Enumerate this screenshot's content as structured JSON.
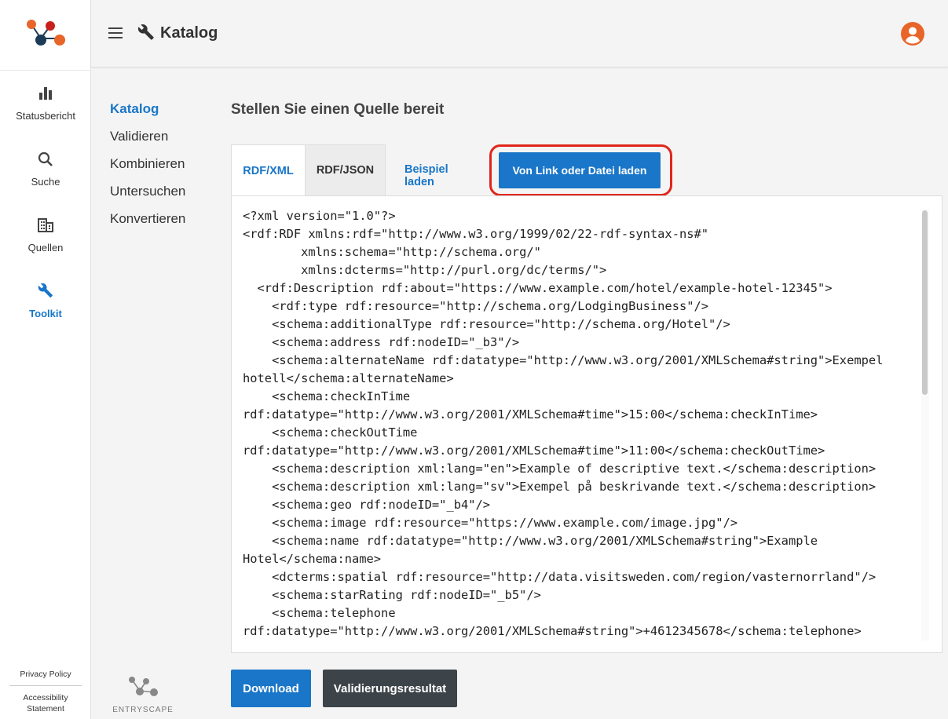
{
  "rail": {
    "items": [
      {
        "label": "Statusbericht",
        "icon": "bar-chart-icon"
      },
      {
        "label": "Suche",
        "icon": "search-icon"
      },
      {
        "label": "Quellen",
        "icon": "building-icon"
      },
      {
        "label": "Toolkit",
        "icon": "wrench-icon"
      }
    ],
    "footer": {
      "privacy": "Privacy Policy",
      "accessibility_1": "Accessibility",
      "accessibility_2": "Statement"
    }
  },
  "header": {
    "title": "Katalog"
  },
  "subnav": [
    "Katalog",
    "Validieren",
    "Kombinieren",
    "Untersuchen",
    "Konvertieren"
  ],
  "main": {
    "title": "Stellen Sie einen Quelle bereit",
    "tabs": [
      "RDF/XML",
      "RDF/JSON"
    ],
    "example_link": "Beispiel laden",
    "load_button": "Von Link oder Datei laden",
    "code": "<?xml version=\"1.0\"?>\n<rdf:RDF xmlns:rdf=\"http://www.w3.org/1999/02/22-rdf-syntax-ns#\"\n        xmlns:schema=\"http://schema.org/\"\n        xmlns:dcterms=\"http://purl.org/dc/terms/\">\n  <rdf:Description rdf:about=\"https://www.example.com/hotel/example-hotel-12345\">\n    <rdf:type rdf:resource=\"http://schema.org/LodgingBusiness\"/>\n    <schema:additionalType rdf:resource=\"http://schema.org/Hotel\"/>\n    <schema:address rdf:nodeID=\"_b3\"/>\n    <schema:alternateName rdf:datatype=\"http://www.w3.org/2001/XMLSchema#string\">Exempel\nhotell</schema:alternateName>\n    <schema:checkInTime\nrdf:datatype=\"http://www.w3.org/2001/XMLSchema#time\">15:00</schema:checkInTime>\n    <schema:checkOutTime\nrdf:datatype=\"http://www.w3.org/2001/XMLSchema#time\">11:00</schema:checkOutTime>\n    <schema:description xml:lang=\"en\">Example of descriptive text.</schema:description>\n    <schema:description xml:lang=\"sv\">Exempel på beskrivande text.</schema:description>\n    <schema:geo rdf:nodeID=\"_b4\"/>\n    <schema:image rdf:resource=\"https://www.example.com/image.jpg\"/>\n    <schema:name rdf:datatype=\"http://www.w3.org/2001/XMLSchema#string\">Example\nHotel</schema:name>\n    <dcterms:spatial rdf:resource=\"http://data.visitsweden.com/region/vasternorrland\"/>\n    <schema:starRating rdf:nodeID=\"_b5\"/>\n    <schema:telephone\nrdf:datatype=\"http://www.w3.org/2001/XMLSchema#string\">+4612345678</schema:telephone>",
    "download_button": "Download",
    "validation_button": "Validierungsresultat"
  },
  "brand": {
    "name": "ENTRYSCAPE"
  },
  "colors": {
    "accent": "#1976c8",
    "highlight": "#e0261b",
    "dark_button": "#3d4449",
    "logo_orange": "#e8652a",
    "logo_red": "#c8201a",
    "logo_navy": "#1c3b57"
  }
}
